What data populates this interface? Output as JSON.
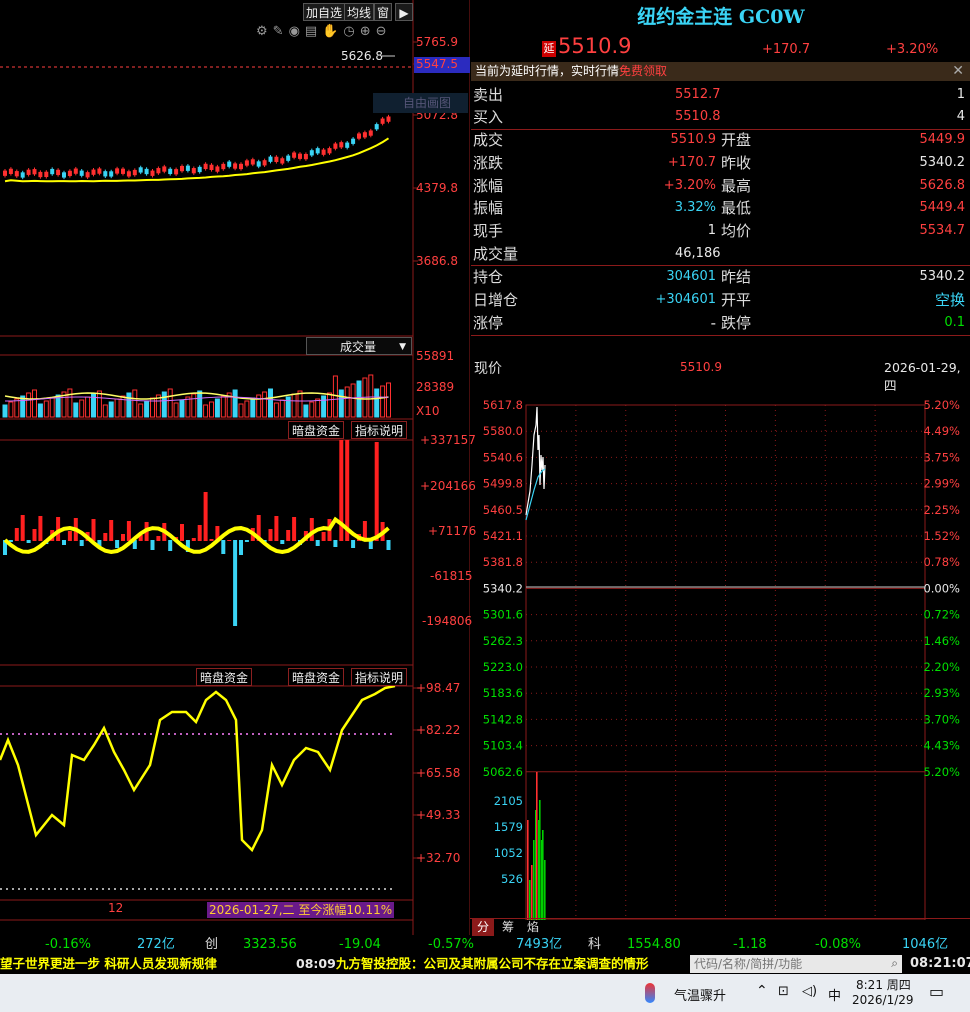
{
  "toolbar": {
    "add_watch": "加自选",
    "avg_line": "均线",
    "window": "窗"
  },
  "kline": {
    "price_ticks": [
      "5765.9",
      "5547.5",
      "5072.8",
      "4379.8",
      "3686.8"
    ],
    "high_marker": "5626.8",
    "overlay_text": "自由画图"
  },
  "volume_panel": {
    "selector": "成交量",
    "ticks": [
      "55891",
      "28389"
    ],
    "multiplier": "X10"
  },
  "dark_pool_panel": {
    "btn_name": "暗盘资金",
    "btn_help": "指标说明",
    "ticks": [
      "+337157",
      "+204166",
      "+71176",
      "-61815",
      "-194806"
    ]
  },
  "indicator_panel": {
    "btn_name_left": "暗盘资金",
    "btn_name": "暗盘资金",
    "btn_help": "指标说明",
    "ticks": [
      "+98.47",
      "+82.22",
      "+65.58",
      "+49.33",
      "+32.70"
    ]
  },
  "bottom_info": {
    "month_label": "12",
    "range_note": "2026-01-27,二 至今涨幅10.11%"
  },
  "quote": {
    "title": "纽约金主连 GC0W",
    "delay_badge": "延",
    "last": "5510.9",
    "change": "+170.7",
    "change_pct": "+3.20%",
    "notice": "当前为延时行情，实时行情",
    "notice_link": "免费领取",
    "ask_label": "卖出",
    "ask_price": "5512.7",
    "ask_vol": "1",
    "bid_label": "买入",
    "bid_price": "5510.8",
    "bid_vol": "4",
    "rows": [
      {
        "l1": "成交",
        "v1": "5510.9",
        "l2": "开盘",
        "v2": "5449.9"
      },
      {
        "l1": "涨跌",
        "v1": "+170.7",
        "l2": "昨收",
        "v2": "5340.2"
      },
      {
        "l1": "涨幅",
        "v1": "+3.20%",
        "l2": "最高",
        "v2": "5626.8"
      },
      {
        "l1": "振幅",
        "v1": "3.32%",
        "l2": "最低",
        "v2": "5449.4"
      },
      {
        "l1": "现手",
        "v1": "1",
        "l2": "均价",
        "v2": "5534.7"
      }
    ],
    "volume_label": "成交量",
    "volume_value": "46,186",
    "oi_label": "持仓",
    "oi_value": "304601",
    "prev_settle_label": "昨结",
    "prev_settle_value": "5340.2",
    "daily_oi_label": "日增仓",
    "daily_oi_value": "+304601",
    "open_close_label": "开平",
    "open_close_value": "空换",
    "limit_up_label": "涨停",
    "limit_up_value": "-",
    "limit_down_label": "跌停",
    "limit_down_value": "0.1"
  },
  "intraday": {
    "label": "现价",
    "price": "5510.9",
    "date": "2026-01-29,四",
    "left_ticks": [
      "5617.8",
      "5580.0",
      "5540.6",
      "5499.8",
      "5460.5",
      "5421.1",
      "5381.8",
      "5340.2",
      "5301.6",
      "5262.3",
      "5223.0",
      "5183.6",
      "5142.8",
      "5103.4",
      "5062.6"
    ],
    "right_ticks": [
      "5.20%",
      "4.49%",
      "3.75%",
      "2.99%",
      "2.25%",
      "1.52%",
      "0.78%",
      "0.00%",
      "0.72%",
      "1.46%",
      "2.20%",
      "2.93%",
      "3.70%",
      "4.43%",
      "5.20%"
    ],
    "vol_ticks": [
      "2105",
      "1579",
      "1052",
      "526"
    ],
    "tabs": [
      "分",
      "筹",
      "焰"
    ]
  },
  "index_bar": {
    "a1": "-0.16%",
    "a2": "272亿",
    "a3": "创",
    "a4": "3323.56",
    "a5": "-19.04",
    "a6": "-0.57%",
    "a7": "7493亿",
    "b1": "科",
    "b2": "1554.80",
    "b3": "-1.18",
    "b4": "-0.08%",
    "b5": "1046亿"
  },
  "news": {
    "left": "望子世界更进一步 科研人员发现新规律",
    "time": "08:09",
    "right": "九方智投控股：公司及其附属公司不存在立案调查的情形",
    "search_placeholder": "代码/名称/简拼/功能",
    "clock": "08:21:07"
  },
  "taskbar": {
    "weather": "气温骤升",
    "ime": "中",
    "time": "8:21 周四",
    "date": "2026/1/29"
  },
  "colors": {
    "up": "#ff4040",
    "down": "#3ad4f5",
    "green": "#00e000",
    "ma": "#ffff00",
    "grid": "#8b1a1a"
  }
}
